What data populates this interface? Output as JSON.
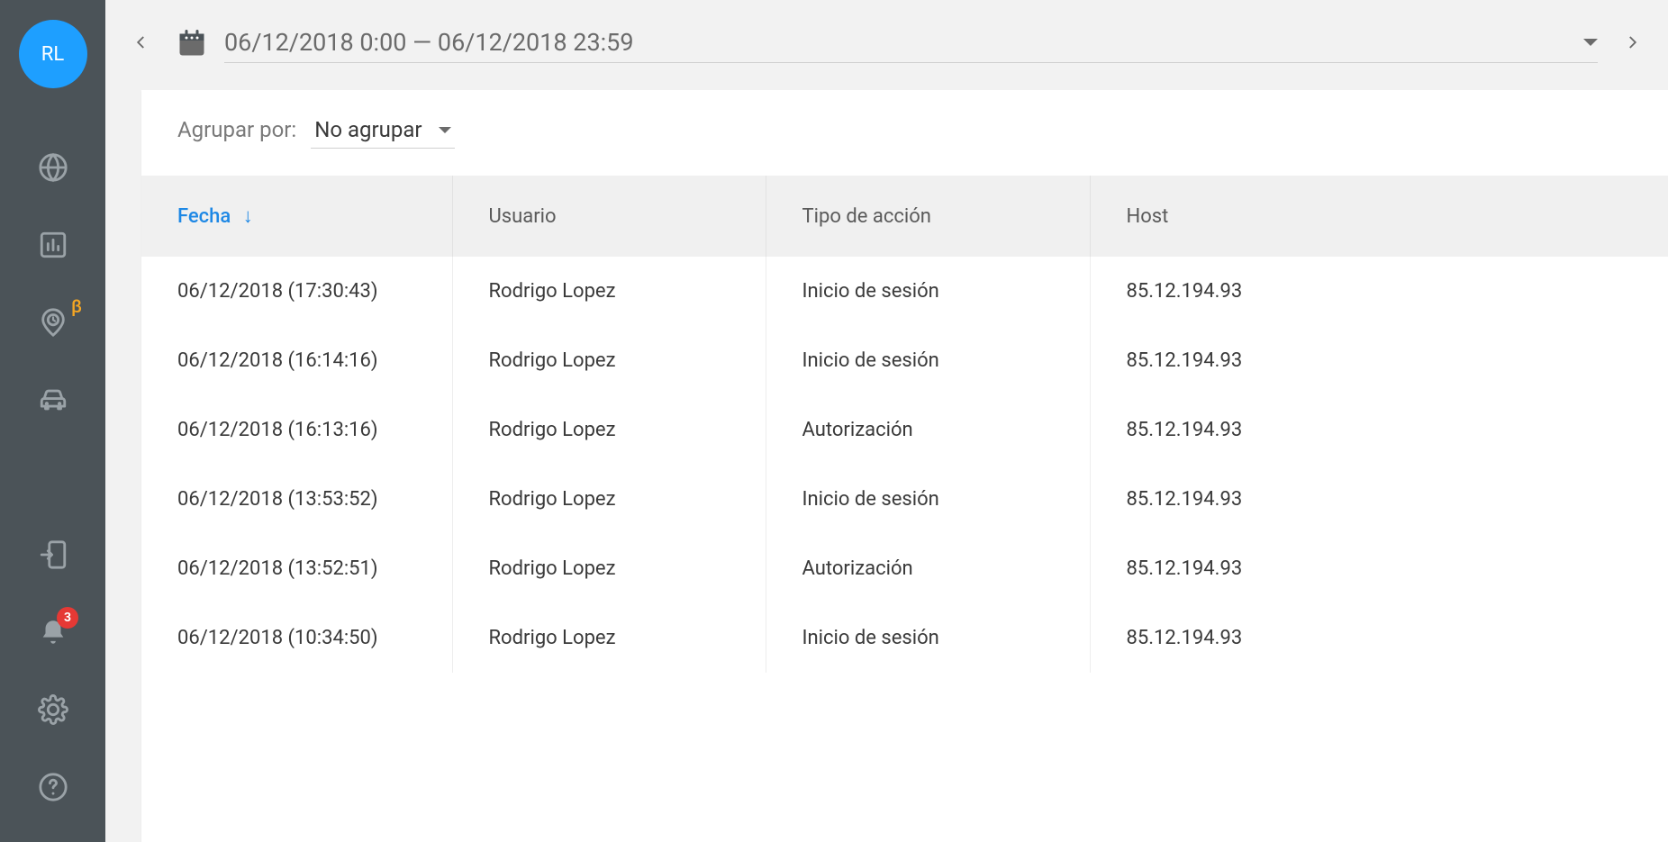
{
  "avatar": {
    "initials": "RL"
  },
  "sidebar": {
    "beta_label": "β",
    "notif_count": "3"
  },
  "datebar": {
    "range_text": "06/12/2018 0:00 — 06/12/2018 23:59"
  },
  "group": {
    "label": "Agrupar por:",
    "value": "No agrupar"
  },
  "table": {
    "headers": {
      "fecha": "Fecha",
      "usuario": "Usuario",
      "accion": "Tipo de acción",
      "host": "Host"
    },
    "rows": [
      {
        "fecha": "06/12/2018 (17:30:43)",
        "usuario": "Rodrigo Lopez",
        "accion": "Inicio de sesión",
        "host": "85.12.194.93"
      },
      {
        "fecha": "06/12/2018 (16:14:16)",
        "usuario": "Rodrigo Lopez",
        "accion": "Inicio de sesión",
        "host": "85.12.194.93"
      },
      {
        "fecha": "06/12/2018 (16:13:16)",
        "usuario": "Rodrigo Lopez",
        "accion": "Autorización",
        "host": "85.12.194.93"
      },
      {
        "fecha": "06/12/2018 (13:53:52)",
        "usuario": "Rodrigo Lopez",
        "accion": "Inicio de sesión",
        "host": "85.12.194.93"
      },
      {
        "fecha": "06/12/2018 (13:52:51)",
        "usuario": "Rodrigo Lopez",
        "accion": "Autorización",
        "host": "85.12.194.93"
      },
      {
        "fecha": "06/12/2018 (10:34:50)",
        "usuario": "Rodrigo Lopez",
        "accion": "Inicio de sesión",
        "host": "85.12.194.93"
      }
    ]
  }
}
